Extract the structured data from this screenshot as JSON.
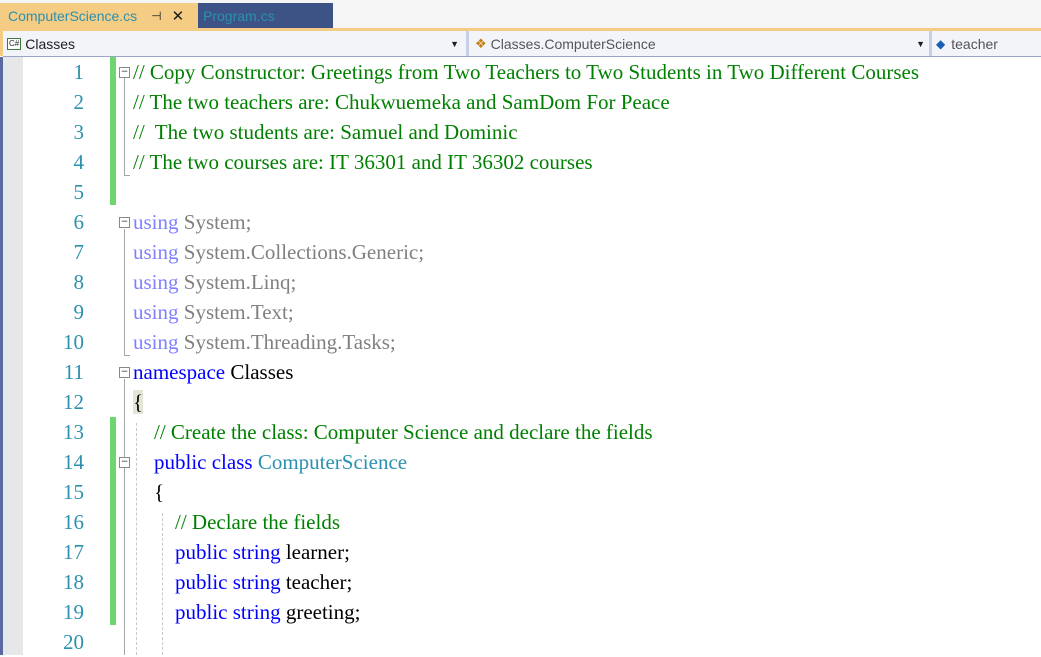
{
  "tabs": [
    {
      "label": "ComputerScience.cs",
      "active": true,
      "pin_icon": "pin-icon",
      "close_icon": "close-icon"
    },
    {
      "label": "Program.cs",
      "active": false
    }
  ],
  "navbar": {
    "project": "Classes",
    "type": "Classes.ComputerScience",
    "member": "teacher"
  },
  "lines": [
    {
      "n": "1",
      "parts": [
        {
          "t": "// Copy Constructor: Greetings from Two Teachers to Two Students in Two Different Courses",
          "c": "c"
        }
      ]
    },
    {
      "n": "2",
      "parts": [
        {
          "t": "// The two teachers are: Chukwuemeka and SamDom For Peace",
          "c": "c"
        }
      ]
    },
    {
      "n": "3",
      "parts": [
        {
          "t": "//  The two students are: Samuel and Dominic",
          "c": "c"
        }
      ]
    },
    {
      "n": "4",
      "parts": [
        {
          "t": "// The two courses are: IT 36301 and IT 36302 courses",
          "c": "c"
        }
      ]
    },
    {
      "n": "5",
      "parts": []
    },
    {
      "n": "6",
      "parts": [
        {
          "t": "using",
          "c": "ku"
        },
        {
          "t": " System;",
          "c": "g"
        }
      ]
    },
    {
      "n": "7",
      "parts": [
        {
          "t": "using",
          "c": "ku"
        },
        {
          "t": " System.Collections.Generic;",
          "c": "g"
        }
      ]
    },
    {
      "n": "8",
      "parts": [
        {
          "t": "using",
          "c": "ku"
        },
        {
          "t": " System.Linq;",
          "c": "g"
        }
      ]
    },
    {
      "n": "9",
      "parts": [
        {
          "t": "using",
          "c": "ku"
        },
        {
          "t": " System.Text;",
          "c": "g"
        }
      ]
    },
    {
      "n": "10",
      "parts": [
        {
          "t": "using",
          "c": "ku"
        },
        {
          "t": " System.Threading.Tasks;",
          "c": "g"
        }
      ]
    },
    {
      "n": "11",
      "parts": [
        {
          "t": "namespace",
          "c": "k"
        },
        {
          "t": " Classes",
          "c": "b"
        }
      ]
    },
    {
      "n": "12",
      "parts": [
        {
          "t": "{",
          "c": "b bracehl"
        }
      ]
    },
    {
      "n": "13",
      "parts": [
        {
          "t": "    // Create the class: Computer Science and declare the fields",
          "c": "c"
        }
      ]
    },
    {
      "n": "14",
      "parts": [
        {
          "t": "    public class",
          "c": "k"
        },
        {
          "t": " ComputerScience",
          "c": "t"
        }
      ]
    },
    {
      "n": "15",
      "parts": [
        {
          "t": "    {",
          "c": "b"
        }
      ]
    },
    {
      "n": "16",
      "parts": [
        {
          "t": "        // Declare the fields",
          "c": "c"
        }
      ]
    },
    {
      "n": "17",
      "parts": [
        {
          "t": "        public string",
          "c": "k"
        },
        {
          "t": " learner;",
          "c": "b"
        }
      ]
    },
    {
      "n": "18",
      "parts": [
        {
          "t": "        public string",
          "c": "k"
        },
        {
          "t": " teacher;",
          "c": "b"
        }
      ]
    },
    {
      "n": "19",
      "parts": [
        {
          "t": "        public string",
          "c": "k"
        },
        {
          "t": " greeting;",
          "c": "b"
        }
      ]
    },
    {
      "n": "20",
      "parts": []
    }
  ],
  "colors": {
    "active_tab": "#f5cc84",
    "inactive_tab": "#3d5285",
    "comment": "#008000",
    "keyword": "#0000ff",
    "type": "#2b91af",
    "line_number": "#2b91af",
    "change_marker": "#6fd66f"
  }
}
